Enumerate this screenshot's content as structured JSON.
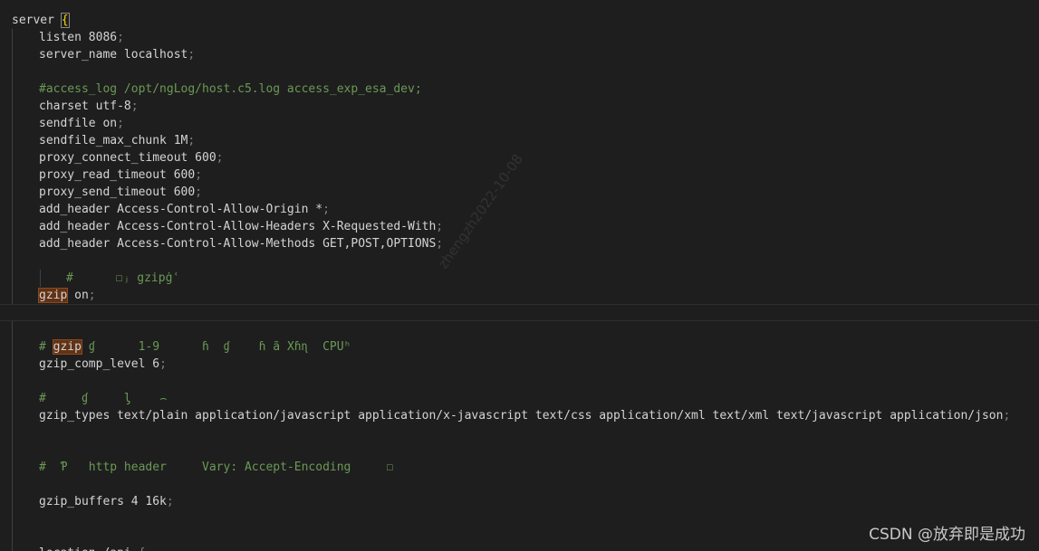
{
  "lines": [
    {
      "indent": 0,
      "text": "server ",
      "brace": "{"
    },
    {
      "indent": 1,
      "text": "listen 8086",
      "semi": ";"
    },
    {
      "indent": 1,
      "text": "server_name localhost",
      "semi": ";"
    },
    {
      "indent": 1,
      "text": ""
    },
    {
      "indent": 1,
      "comment": "#access_log /opt/ngLog/host.c5.log access_exp_esa_dev;"
    },
    {
      "indent": 1,
      "text": "charset utf-8",
      "semi": ";"
    },
    {
      "indent": 1,
      "text": "sendfile on",
      "semi": ";"
    },
    {
      "indent": 1,
      "text": "sendfile_max_chunk 1M",
      "semi": ";"
    },
    {
      "indent": 1,
      "text": "proxy_connect_timeout 600",
      "semi": ";"
    },
    {
      "indent": 1,
      "text": "proxy_read_timeout 600",
      "semi": ";"
    },
    {
      "indent": 1,
      "text": "proxy_send_timeout 600",
      "semi": ";"
    },
    {
      "indent": 1,
      "text": "add_header Access-Control-Allow-Origin *",
      "semi": ";"
    },
    {
      "indent": 1,
      "text": "add_header Access-Control-Allow-Headers X-Requested-With",
      "semi": ";"
    },
    {
      "indent": 1,
      "text": "add_header Access-Control-Allow-Methods GET,POST,OPTIONS",
      "semi": ";"
    },
    {
      "indent": 1,
      "text": ""
    },
    {
      "indent": 2,
      "comment": "#      ☐ⱼ gzipġʿ"
    },
    {
      "indent": 1,
      "hl": "gzip",
      "text": " on",
      "semi": ";"
    },
    {
      "indent": 0,
      "text": "",
      "current": true
    },
    {
      "indent": 1,
      "text": ""
    },
    {
      "indent": 1,
      "comment_pre": "# ",
      "hl": "gzip",
      "comment": " ɠ      1-9      ɦ  ɠ    ɦ ã Xɦɳ  CPUʰ"
    },
    {
      "indent": 1,
      "text": "gzip_comp_level 6",
      "semi": ";"
    },
    {
      "indent": 1,
      "text": ""
    },
    {
      "indent": 1,
      "comment": "#     ɠ     ᶅ    ⌢"
    },
    {
      "indent": 1,
      "text": "gzip_types text/plain application/javascript application/x-javascript text/css application/xml text/xml text/javascript application/json",
      "semi": ";"
    },
    {
      "indent": 1,
      "text": ""
    },
    {
      "indent": 1,
      "text": ""
    },
    {
      "indent": 1,
      "comment": "#  Ƥ   http header     Vary: Accept-Encoding     ☐"
    },
    {
      "indent": 1,
      "text": ""
    },
    {
      "indent": 1,
      "text": "gzip_buffers 4 16k",
      "semi": ";"
    },
    {
      "indent": 1,
      "text": ""
    },
    {
      "indent": 1,
      "text": ""
    },
    {
      "indent": 1,
      "text": "location /api",
      "semi": " {"
    }
  ],
  "watermark": "zhengzh2022-10-08",
  "csdn_mark": "CSDN @放弃即是成功"
}
